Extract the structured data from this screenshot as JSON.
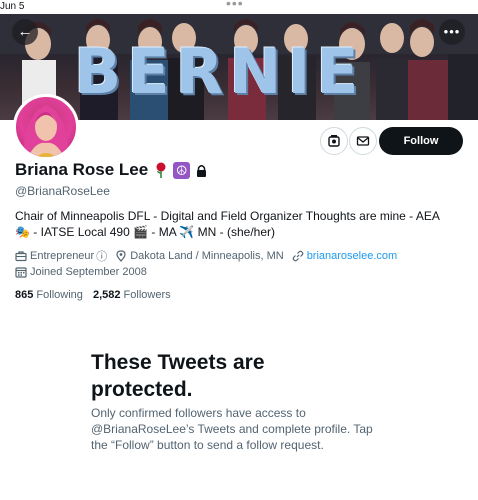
{
  "status_bar": {
    "date": "Jun 5",
    "dots": "•••"
  },
  "banner": {
    "sign_text": "BERNIE"
  },
  "nav": {
    "back_glyph": "←",
    "more_glyph": "•••"
  },
  "profile": {
    "display_name": "Briana Rose Lee",
    "peace_glyph": "☮",
    "handle": "@BrianaRoseLee",
    "bio_line1": "Chair of Minneapolis DFL - Digital and Field Organizer Thoughts are mine - AEA",
    "bio_line2": "🎭 - IATSE Local 490 🎬 - MA ✈️ MN - (she/her)",
    "category": "Entrepreneur",
    "category_info_glyph": "ⓘ",
    "location": "Dakota Land / Minneapolis, MN",
    "website": "brianaroselee.com",
    "joined": "Joined September 2008"
  },
  "stats": {
    "following_count": "865",
    "following_label": "Following",
    "followers_count": "2,582",
    "followers_label": "Followers"
  },
  "actions": {
    "follow_label": "Follow"
  },
  "protected": {
    "title": "These Tweets are protected.",
    "body": "Only confirmed followers have access to @BrianaRoseLee’s Tweets and complete profile. Tap the “Follow” button to send a follow request."
  },
  "icons": [
    "back-arrow-icon",
    "more-icon",
    "recommend-icon",
    "mail-icon",
    "rose-icon",
    "peace-icon",
    "lock-icon",
    "briefcase-icon",
    "location-pin-icon",
    "link-icon",
    "calendar-icon"
  ],
  "colors": {
    "accent": "#1d9bf0",
    "follow_button": "#0f1419",
    "secondary_text": "#536471",
    "peace_badge": "#9356c4"
  }
}
